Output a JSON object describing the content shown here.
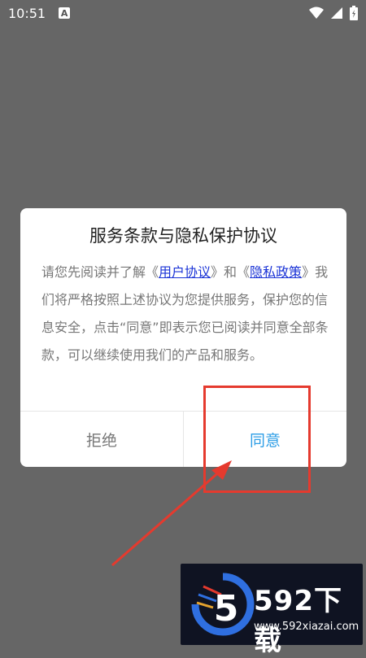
{
  "status_bar": {
    "time": "10:51",
    "notification_badge": "A"
  },
  "dialog": {
    "title": "服务条款与隐私保护协议",
    "body_prefix": "请您先阅读并了解《",
    "link_user": "用户协议",
    "body_middle": "》和《",
    "link_privacy": "隐私政策",
    "body_suffix": "》我们将严格按照上述协议为您提供服务，保护您的信息安全，点击“同意”即表示您已阅读并同意全部条款，可以继续使用我们的产品和服务。",
    "refuse_label": "拒绝",
    "agree_label": "同意"
  },
  "annotation": {
    "color": "#e53a2e"
  },
  "watermark": {
    "logo_digit": "5",
    "title": "592下载",
    "url": "www.592xiazai.com"
  },
  "colors": {
    "overlay": "#666666",
    "link": "#1a33d6",
    "agree": "#2e9ee6"
  }
}
